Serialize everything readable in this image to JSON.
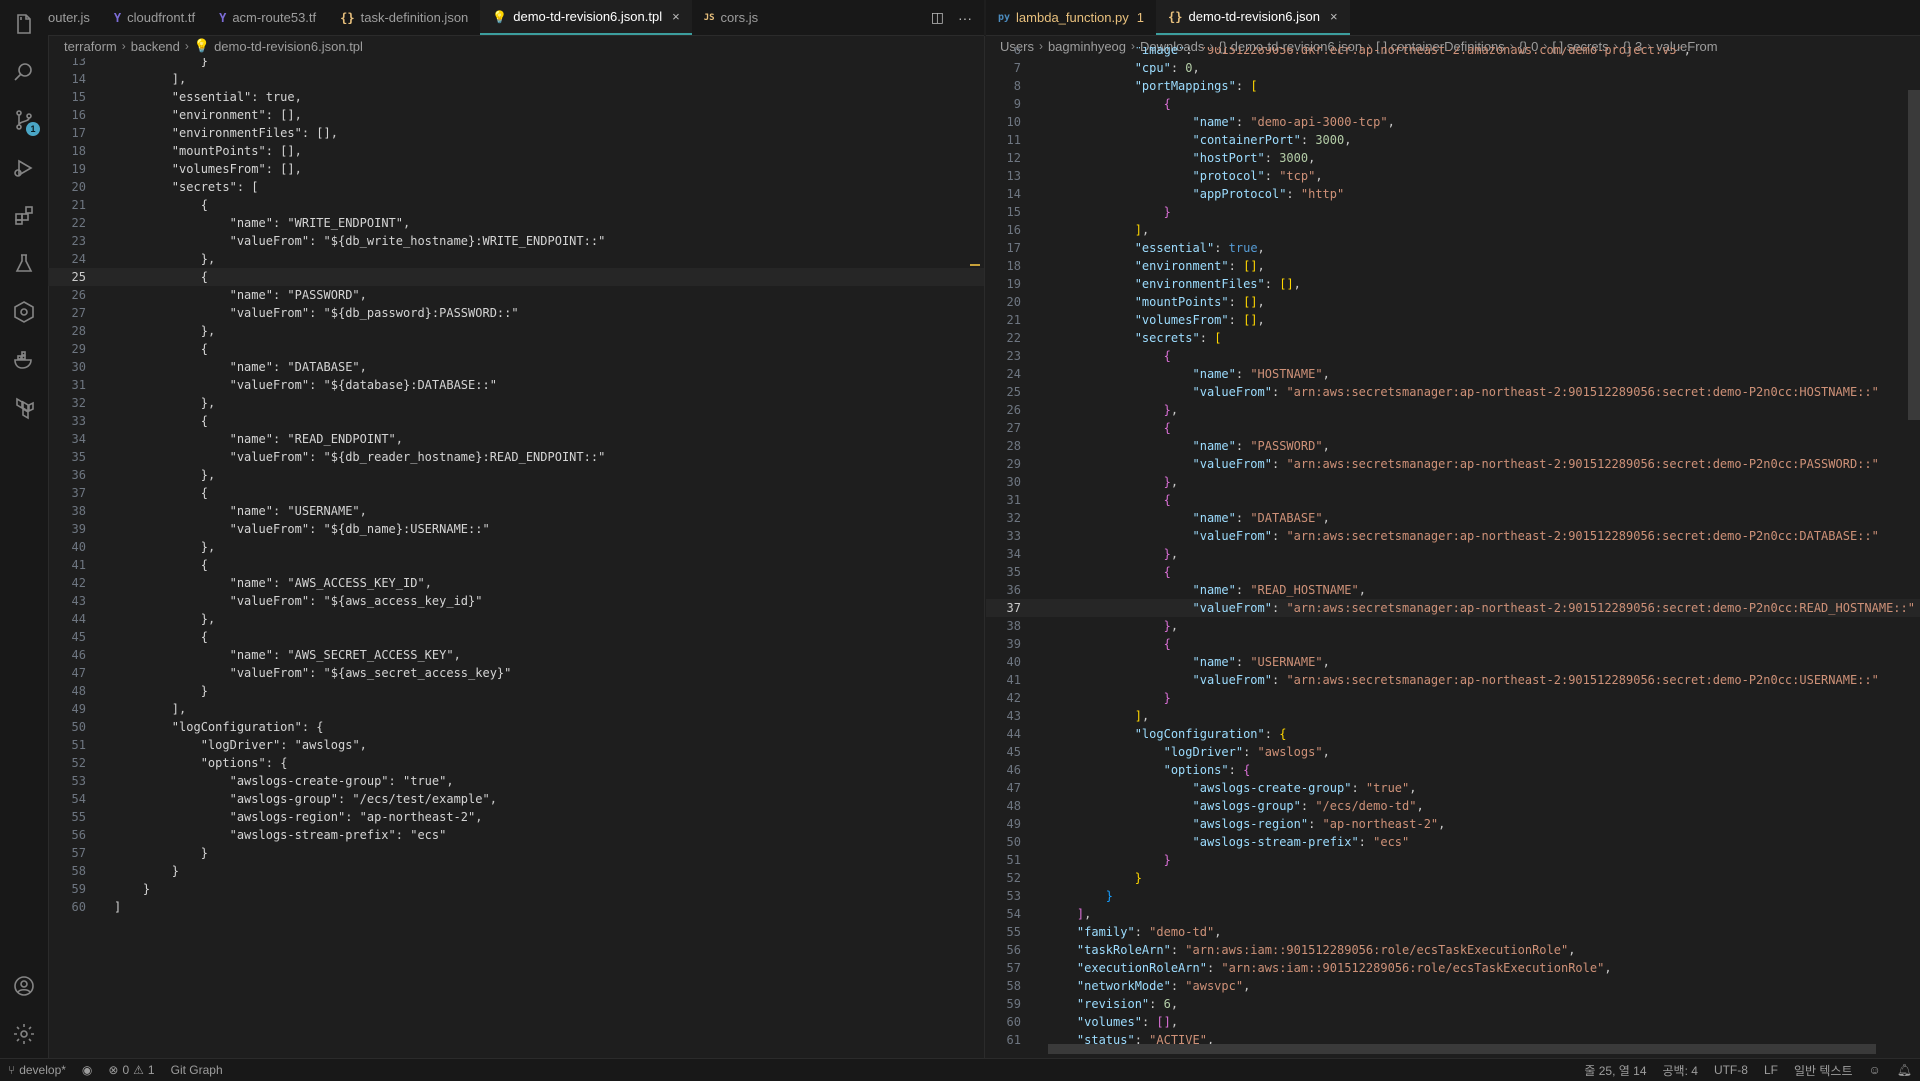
{
  "left_tabs": [
    {
      "icon": "",
      "label": "outer.js",
      "active": false
    },
    {
      "icon": "Y",
      "label": "cloudfront.tf",
      "active": false
    },
    {
      "icon": "Y",
      "label": "acm-route53.tf",
      "active": false
    },
    {
      "icon": "{}",
      "label": "task-definition.json",
      "active": false
    },
    {
      "icon": "💡",
      "label": "demo-td-revision6.json.tpl",
      "active": true,
      "close": "×"
    },
    {
      "icon": "JS",
      "label": "cors.js",
      "active": false
    }
  ],
  "right_tabs": [
    {
      "icon": "py",
      "label": "lambda_function.py",
      "active": false,
      "count": "1"
    },
    {
      "icon": "{}",
      "label": "demo-td-revision6.json",
      "active": true,
      "close": "×"
    }
  ],
  "left_breadcrumb": [
    "terraform",
    "backend",
    "demo-td-revision6.json.tpl"
  ],
  "right_breadcrumb": [
    "Users",
    "bagminhyeog",
    "Downloads",
    "{} demo-td-revision6.json",
    "[ ] containerDefinitions",
    "{} 0",
    "[ ] secrets",
    "{} 3",
    "valueFrom"
  ],
  "left_code": {
    "start": 13,
    "current": 25,
    "lines": [
      "            }",
      "        ],",
      "        \"essential\": true,",
      "        \"environment\": [],",
      "        \"environmentFiles\": [],",
      "        \"mountPoints\": [],",
      "        \"volumesFrom\": [],",
      "        \"secrets\": [",
      "            {",
      "                \"name\": \"WRITE_ENDPOINT\",",
      "                \"valueFrom\": \"${db_write_hostname}:WRITE_ENDPOINT::\"",
      "            },",
      "            {",
      "                \"name\": \"PASSWORD\",",
      "                \"valueFrom\": \"${db_password}:PASSWORD::\"",
      "            },",
      "            {",
      "                \"name\": \"DATABASE\",",
      "                \"valueFrom\": \"${database}:DATABASE::\"",
      "            },",
      "            {",
      "                \"name\": \"READ_ENDPOINT\",",
      "                \"valueFrom\": \"${db_reader_hostname}:READ_ENDPOINT::\"",
      "            },",
      "            {",
      "                \"name\": \"USERNAME\",",
      "                \"valueFrom\": \"${db_name}:USERNAME::\"",
      "            },",
      "            {",
      "                \"name\": \"AWS_ACCESS_KEY_ID\",",
      "                \"valueFrom\": \"${aws_access_key_id}\"",
      "            },",
      "            {",
      "                \"name\": \"AWS_SECRET_ACCESS_KEY\",",
      "                \"valueFrom\": \"${aws_secret_access_key}\"",
      "            }",
      "        ],",
      "        \"logConfiguration\": {",
      "            \"logDriver\": \"awslogs\",",
      "            \"options\": {",
      "                \"awslogs-create-group\": \"true\",",
      "                \"awslogs-group\": \"/ecs/test/example\",",
      "                \"awslogs-region\": \"ap-northeast-2\",",
      "                \"awslogs-stream-prefix\": \"ecs\"",
      "            }",
      "        }",
      "    }",
      "]"
    ]
  },
  "right_code": {
    "start": 6,
    "current": 37,
    "lines": [
      "            \"image\": \"901512289056.dkr.ecr.ap-northeast-2.amazonaws.com/demo-project:v5\",",
      "            \"cpu\": 0,",
      "            \"portMappings\": [",
      "                {",
      "                    \"name\": \"demo-api-3000-tcp\",",
      "                    \"containerPort\": 3000,",
      "                    \"hostPort\": 3000,",
      "                    \"protocol\": \"tcp\",",
      "                    \"appProtocol\": \"http\"",
      "                }",
      "            ],",
      "            \"essential\": true,",
      "            \"environment\": [],",
      "            \"environmentFiles\": [],",
      "            \"mountPoints\": [],",
      "            \"volumesFrom\": [],",
      "            \"secrets\": [",
      "                {",
      "                    \"name\": \"HOSTNAME\",",
      "                    \"valueFrom\": \"arn:aws:secretsmanager:ap-northeast-2:901512289056:secret:demo-P2n0cc:HOSTNAME::\"",
      "                },",
      "                {",
      "                    \"name\": \"PASSWORD\",",
      "                    \"valueFrom\": \"arn:aws:secretsmanager:ap-northeast-2:901512289056:secret:demo-P2n0cc:PASSWORD::\"",
      "                },",
      "                {",
      "                    \"name\": \"DATABASE\",",
      "                    \"valueFrom\": \"arn:aws:secretsmanager:ap-northeast-2:901512289056:secret:demo-P2n0cc:DATABASE::\"",
      "                },",
      "                {",
      "                    \"name\": \"READ_HOSTNAME\",",
      "                    \"valueFrom\": \"arn:aws:secretsmanager:ap-northeast-2:901512289056:secret:demo-P2n0cc:READ_HOSTNAME::\"",
      "                },",
      "                {",
      "                    \"name\": \"USERNAME\",",
      "                    \"valueFrom\": \"arn:aws:secretsmanager:ap-northeast-2:901512289056:secret:demo-P2n0cc:USERNAME::\"",
      "                }",
      "            ],",
      "            \"logConfiguration\": {",
      "                \"logDriver\": \"awslogs\",",
      "                \"options\": {",
      "                    \"awslogs-create-group\": \"true\",",
      "                    \"awslogs-group\": \"/ecs/demo-td\",",
      "                    \"awslogs-region\": \"ap-northeast-2\",",
      "                    \"awslogs-stream-prefix\": \"ecs\"",
      "                }",
      "            }",
      "        }",
      "    ],",
      "    \"family\": \"demo-td\",",
      "    \"taskRoleArn\": \"arn:aws:iam::901512289056:role/ecsTaskExecutionRole\",",
      "    \"executionRoleArn\": \"arn:aws:iam::901512289056:role/ecsTaskExecutionRole\",",
      "    \"networkMode\": \"awsvpc\",",
      "    \"revision\": 6,",
      "    \"volumes\": [],",
      "    \"status\": \"ACTIVE\","
    ]
  },
  "status": {
    "branch": "develop*",
    "errors": "0",
    "warnings": "1",
    "git_graph": "Git Graph",
    "position": "줄 25, 열 14",
    "spaces": "공백: 4",
    "encoding": "UTF-8",
    "eol": "LF",
    "language": "일반 텍스트"
  },
  "source_control_badge": "1",
  "colors": {
    "accent": "#3c9e9e",
    "key": "#9cdcfe",
    "string": "#ce9178",
    "number": "#b5cea8",
    "keyword": "#569cd6"
  }
}
